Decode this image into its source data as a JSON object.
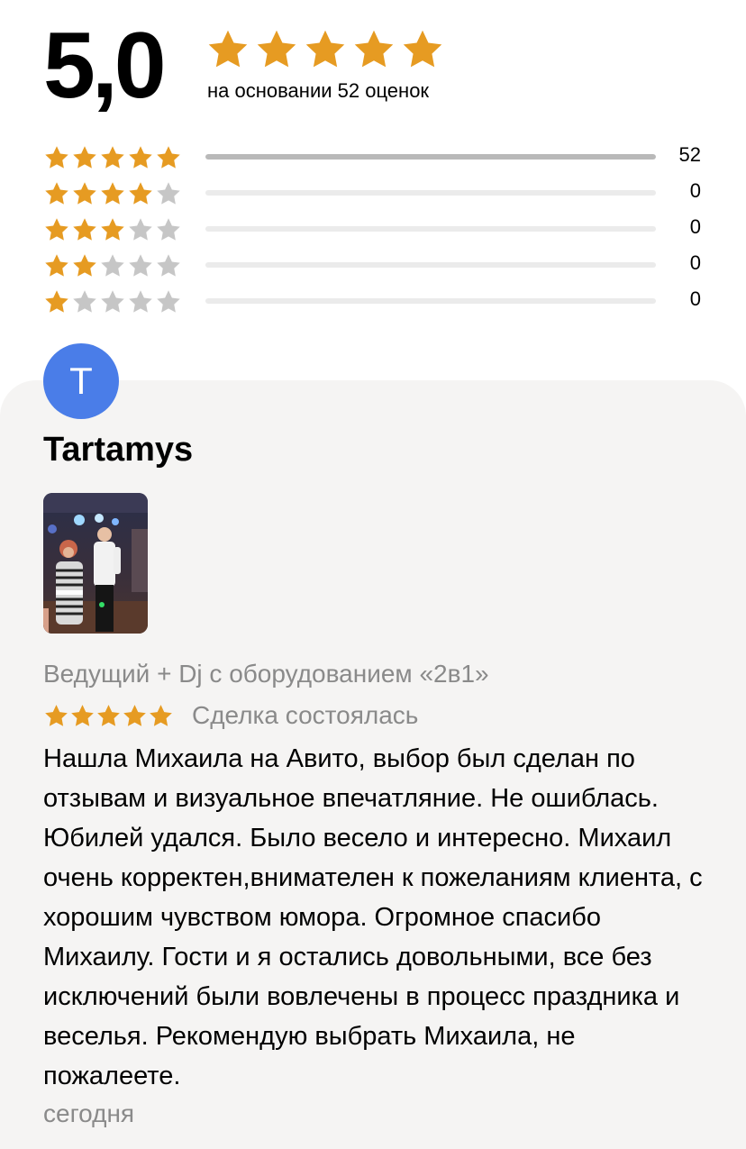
{
  "colors": {
    "star_filled": "#e69b22",
    "star_empty": "#c6c6c6",
    "avatar_bg": "#4a7de8",
    "card_bg": "#f5f4f3"
  },
  "rating_summary": {
    "score": "5,0",
    "stars_filled": 5,
    "caption": "на основании 52 оценок"
  },
  "breakdown": [
    {
      "stars": 5,
      "count": "52",
      "fraction": 1.0
    },
    {
      "stars": 4,
      "count": "0",
      "fraction": 0
    },
    {
      "stars": 3,
      "count": "0",
      "fraction": 0
    },
    {
      "stars": 2,
      "count": "0",
      "fraction": 0
    },
    {
      "stars": 1,
      "count": "0",
      "fraction": 0
    }
  ],
  "review": {
    "avatar_letter": "T",
    "author": "Tartamys",
    "service": "Ведущий + Dj с оборудованием «2в1»",
    "stars": 5,
    "deal_status": "Сделка состоялась",
    "text": "Нашла Михаила на Авито, выбор был сделан по отзывам и визуальное впечатляние. Не ошиблась. Юбилей удался. Было весело и интересно. Михаил очень корректен,внимателен к пожеланиям клиента, с хорошим чувством юмора. Огромное спасибо Михаилу. Гости и я остались довольными, все без исключений были вовлечены в процесс праздника и веселья. Рекомендую выбрать Михаила, не пожалеете.",
    "date": "сегодня",
    "photo_icon": "review-photo"
  }
}
